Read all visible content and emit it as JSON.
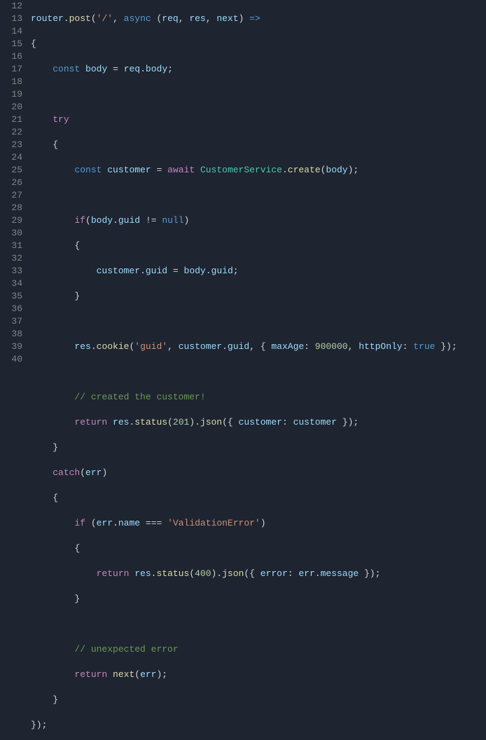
{
  "gutter": {
    "start": 12,
    "end": 40
  },
  "code": {
    "l12": {
      "obj1": "router",
      "fn1": "post",
      "str1": "'/'",
      "kw1": "async",
      "obj2": "req",
      "obj3": "res",
      "obj4": "next",
      "op": "=>"
    },
    "l13": {
      "br": "{"
    },
    "l14": {
      "kw": "const",
      "v": "body",
      "eq": "=",
      "r1": "req",
      "r2": "body",
      "semi": ";"
    },
    "l16": {
      "kw": "try"
    },
    "l17": {
      "br": "{"
    },
    "l18": {
      "kw": "const",
      "v": "customer",
      "eq": "=",
      "aw": "await",
      "cls": "CustomerService",
      "fn": "create",
      "arg": "body"
    },
    "l20": {
      "kw": "if",
      "a": "body",
      "b": "guid",
      "op": "!=",
      "nl": "null"
    },
    "l21": {
      "br": "{"
    },
    "l22": {
      "a": "customer",
      "b": "guid",
      "eq": "=",
      "c": "body",
      "d": "guid"
    },
    "l23": {
      "br": "}"
    },
    "l25": {
      "a": "res",
      "fn": "cookie",
      "s": "'guid'",
      "c": "customer",
      "d": "guid",
      "m": "maxAge",
      "n": "900000",
      "h": "httpOnly",
      "t": "true"
    },
    "l27": {
      "cmt": "// created the customer!"
    },
    "l28": {
      "kw": "return",
      "a": "res",
      "fn1": "status",
      "n": "201",
      "fn2": "json",
      "p1": "customer",
      "p2": "customer"
    },
    "l29": {
      "br": "}"
    },
    "l30": {
      "kw": "catch",
      "e": "err"
    },
    "l31": {
      "br": "{"
    },
    "l32": {
      "kw": "if",
      "a": "err",
      "b": "name",
      "op": "===",
      "s": "'ValidationError'"
    },
    "l33": {
      "br": "{"
    },
    "l34": {
      "kw": "return",
      "a": "res",
      "fn1": "status",
      "n": "400",
      "fn2": "json",
      "p": "error",
      "e": "err",
      "m": "message"
    },
    "l35": {
      "br": "}"
    },
    "l37": {
      "cmt": "// unexpected error"
    },
    "l38": {
      "kw": "return",
      "fn": "next",
      "a": "err"
    },
    "l39": {
      "br": "}"
    },
    "l40": {
      "txt": "});"
    }
  }
}
